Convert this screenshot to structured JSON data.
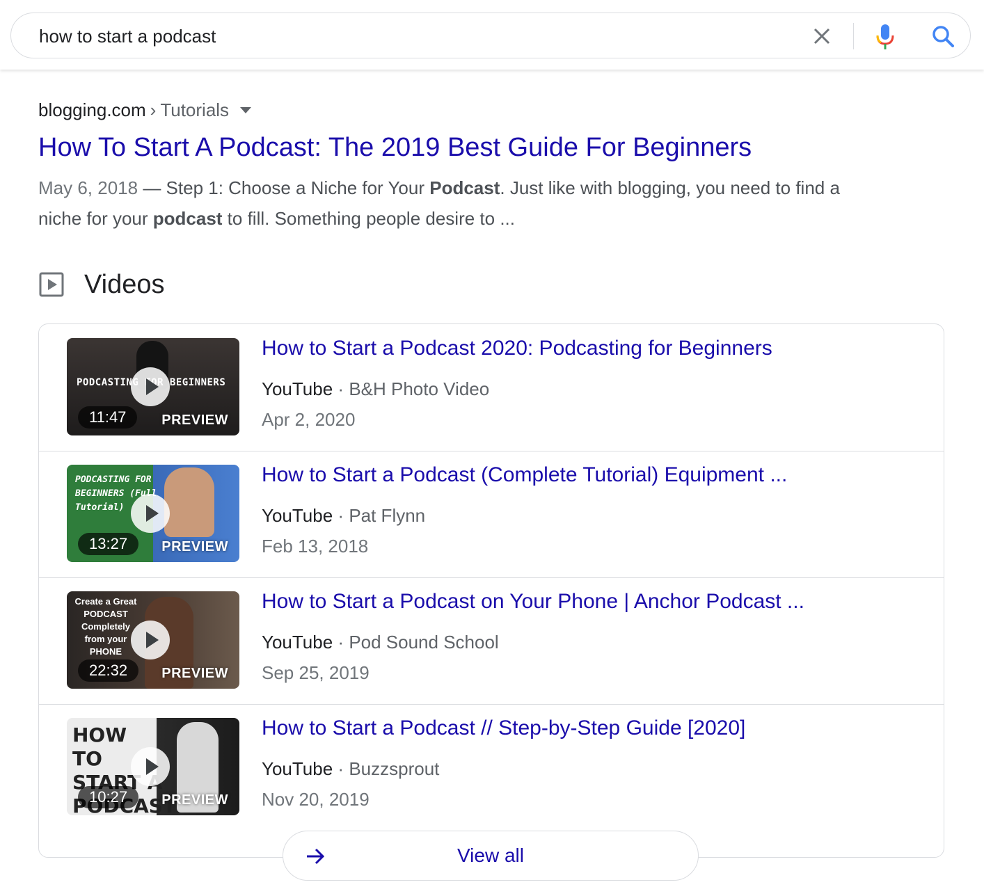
{
  "search": {
    "query": "how to start a podcast"
  },
  "result": {
    "domain": "blogging.com",
    "separator": "›",
    "path": "Tutorials",
    "title": "How To Start A Podcast: The 2019 Best Guide For Beginners",
    "date": "May 6, 2018",
    "snippet_parts": {
      "p1": " — Step 1: Choose a Niche for Your ",
      "b1": "Podcast",
      "p2": ". Just like with blogging, you need to find a niche for your ",
      "b2": "podcast",
      "p3": " to fill. Something people desire to ..."
    }
  },
  "videos": {
    "header": "Videos",
    "items": [
      {
        "title": "How to Start a Podcast 2020: Podcasting for Beginners",
        "source": "YouTube",
        "dot": "·",
        "channel": "B&H Photo Video",
        "date": "Apr 2, 2020",
        "duration": "11:47",
        "preview": "PREVIEW",
        "thumb_text": "PODCASTING FOR BEGINNERS",
        "thumb_bg": "#2b2a2a"
      },
      {
        "title": "How to Start a Podcast (Complete Tutorial) Equipment ...",
        "source": "YouTube",
        "dot": "·",
        "channel": "Pat Flynn",
        "date": "Feb 13, 2018",
        "duration": "13:27",
        "preview": "PREVIEW",
        "thumb_text": "PODCASTING FOR BEGINNERS (Full Tutorial)",
        "thumb_bg": "#2f7d3b"
      },
      {
        "title": "How to Start a Podcast on Your Phone | Anchor Podcast ...",
        "source": "YouTube",
        "dot": "·",
        "channel": "Pod Sound School",
        "date": "Sep 25, 2019",
        "duration": "22:32",
        "preview": "PREVIEW",
        "thumb_text": "Create a Great PODCAST Completely from your PHONE",
        "thumb_bg": "#3a3330"
      },
      {
        "title": "How to Start a Podcast // Step-by-Step Guide [2020]",
        "source": "YouTube",
        "dot": "·",
        "channel": "Buzzsprout",
        "date": "Nov 20, 2019",
        "duration": "10:27",
        "preview": "PREVIEW",
        "thumb_text": "HOW TO START A PODCAST",
        "thumb_bg": "#e9e9e9"
      }
    ],
    "view_all": "View all"
  },
  "colors": {
    "link": "#1a0dab",
    "text": "#202124",
    "muted": "#70757a",
    "border": "#dadce0",
    "google_blue": "#4285f4",
    "google_red": "#ea4335",
    "google_yellow": "#fbbc05",
    "google_green": "#34a853"
  }
}
